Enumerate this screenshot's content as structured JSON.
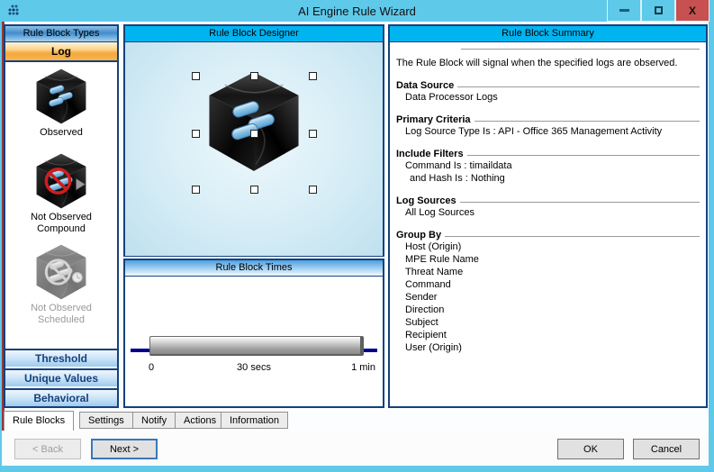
{
  "window": {
    "title": "AI Engine Rule Wizard"
  },
  "left_panel": {
    "header": "Rule Block Types",
    "selected_type": "Log",
    "items": [
      {
        "label1": "Observed",
        "label2": "",
        "icon": "cube-observed-icon",
        "disabled": false
      },
      {
        "label1": "Not Observed",
        "label2": "Compound",
        "icon": "cube-not-observed-icon",
        "disabled": false
      },
      {
        "label1": "Not Observed",
        "label2": "Scheduled",
        "icon": "cube-scheduled-icon",
        "disabled": true
      }
    ],
    "accordion_buttons": [
      "Threshold",
      "Unique Values",
      "Behavioral"
    ]
  },
  "designer": {
    "header": "Rule Block Designer"
  },
  "times": {
    "header": "Rule Block Times",
    "ticks": {
      "start": "0",
      "mid": "30 secs",
      "end": "1 min"
    }
  },
  "summary": {
    "header": "Rule Block Summary",
    "intro": "The Rule Block will signal when the specified logs are observed.",
    "sections": [
      {
        "title": "Data Source",
        "lines": [
          "Data Processor Logs"
        ]
      },
      {
        "title": "Primary Criteria",
        "lines": [
          "Log Source Type Is : API - Office 365 Management Activity"
        ]
      },
      {
        "title": "Include Filters",
        "lines": [
          "Command Is : timaildata",
          "and Hash Is :  Nothing"
        ]
      },
      {
        "title": "Log Sources",
        "lines": [
          "All Log Sources"
        ]
      },
      {
        "title": "Group By",
        "lines": [
          "Host (Origin)",
          "MPE Rule Name",
          "Threat Name",
          "Command",
          "Sender",
          "Direction",
          "Subject",
          "Recipient",
          "User (Origin)"
        ]
      }
    ]
  },
  "tabs": [
    {
      "label": "Rule Blocks",
      "active": true
    },
    {
      "label": "Settings",
      "active": false
    },
    {
      "label": "Notify",
      "active": false
    },
    {
      "label": "Actions",
      "active": false
    },
    {
      "label": "Information",
      "active": false
    }
  ],
  "footer": {
    "back": "< Back",
    "next": "Next >",
    "ok": "OK",
    "cancel": "Cancel"
  },
  "colors": {
    "titlebar": "#5fc9ea",
    "close_button": "#c75050",
    "panel_header_cyan": "#00b4f0",
    "panel_border_navy": "#16417c",
    "log_selected_orange": "#f3a93c",
    "slider_line_navy": "#00008b",
    "left_edge_maroon": "#93383b"
  }
}
